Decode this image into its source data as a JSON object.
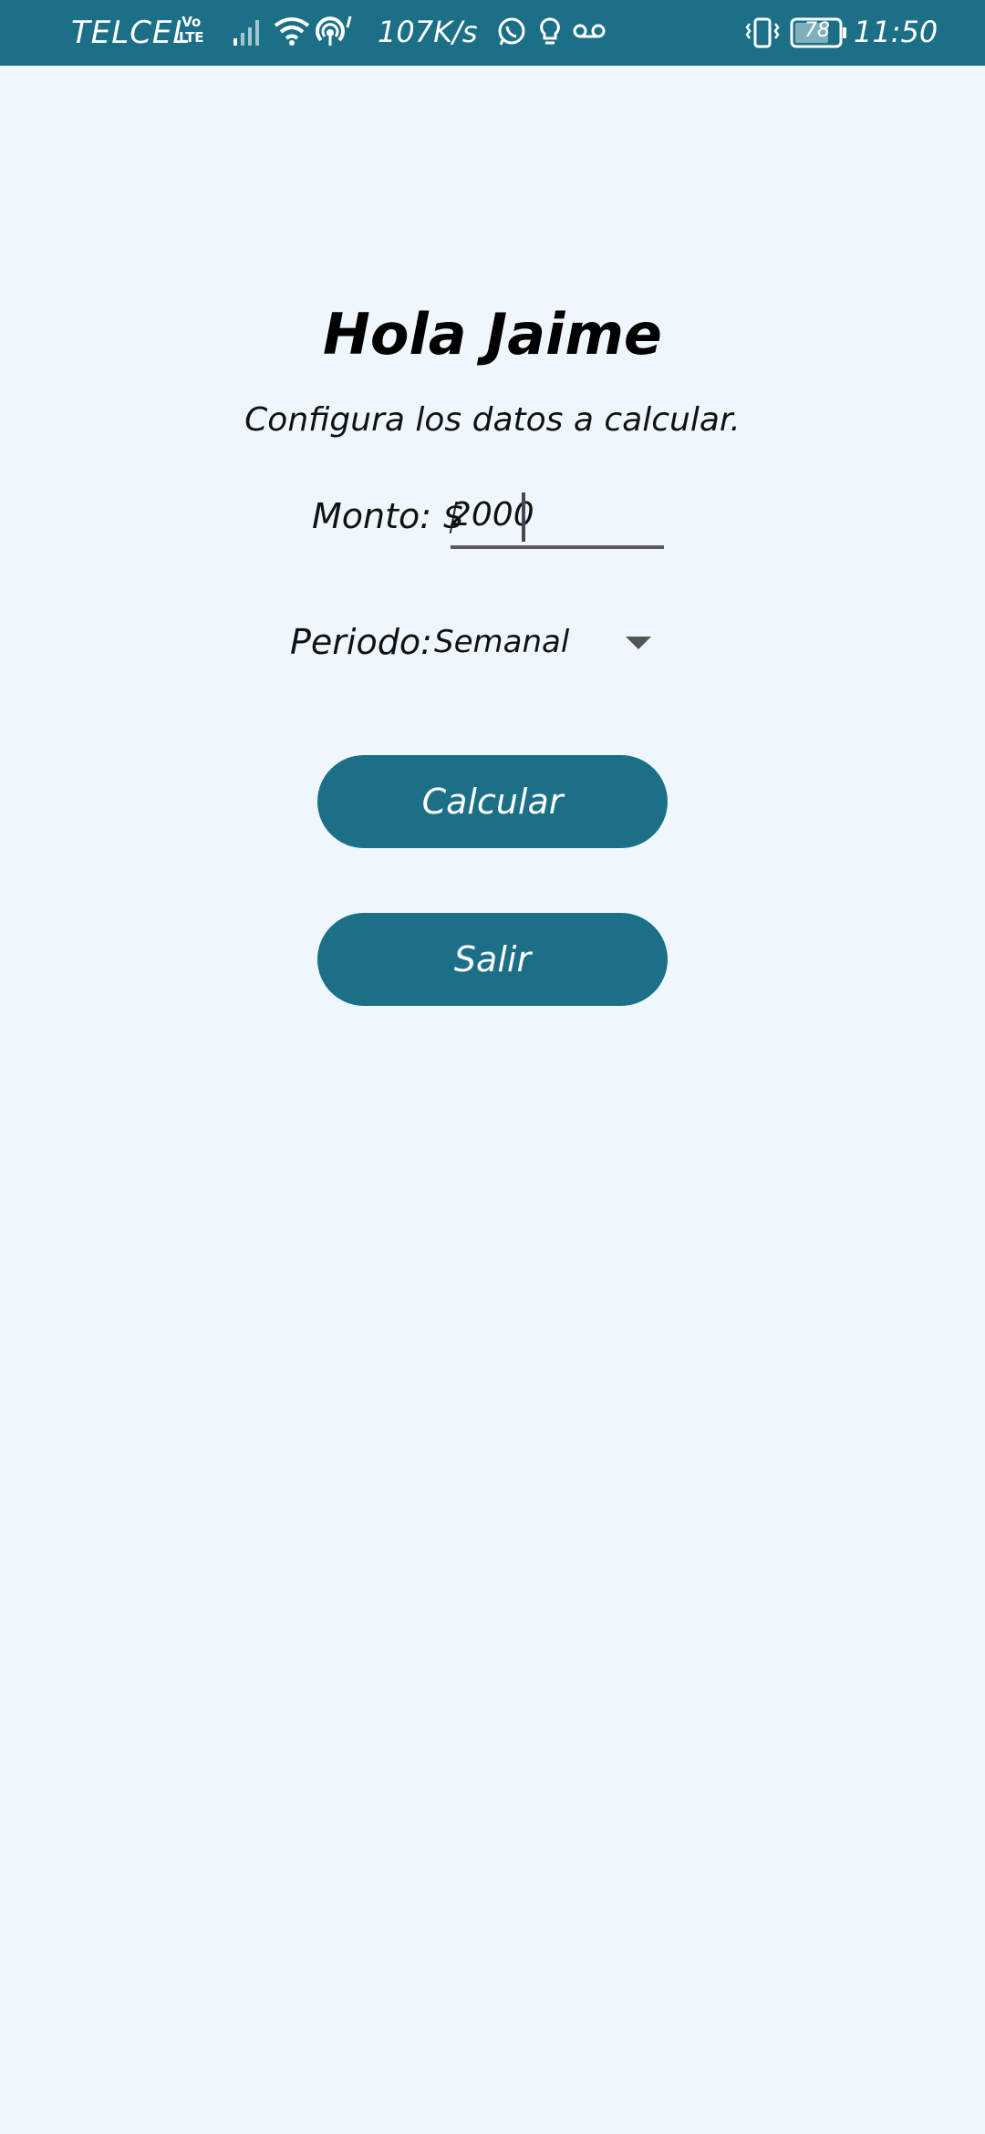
{
  "status_bar": {
    "carrier": "TELCEL",
    "volte_top": "Vo",
    "volte_bottom": "LTE",
    "speed": "107K/s",
    "battery": "78",
    "time": "11:50",
    "icons": [
      "signal-icon",
      "wifi-icon",
      "hotspot-icon",
      "whatsapp-icon",
      "bulb-icon",
      "voicemail-icon",
      "vibrate-icon",
      "battery-icon"
    ]
  },
  "main": {
    "greeting": "Hola Jaime",
    "subtitle": "Configura los datos a calcular.",
    "monto_label": "Monto: $",
    "monto_value": "2000",
    "periodo_label": "Periodo:",
    "periodo_value": "Semanal"
  },
  "buttons": {
    "calculate": "Calcular",
    "exit": "Salir"
  },
  "colors": {
    "primary": "#1b6f87",
    "background": "#eff7fd",
    "underline": "#5b5763"
  }
}
